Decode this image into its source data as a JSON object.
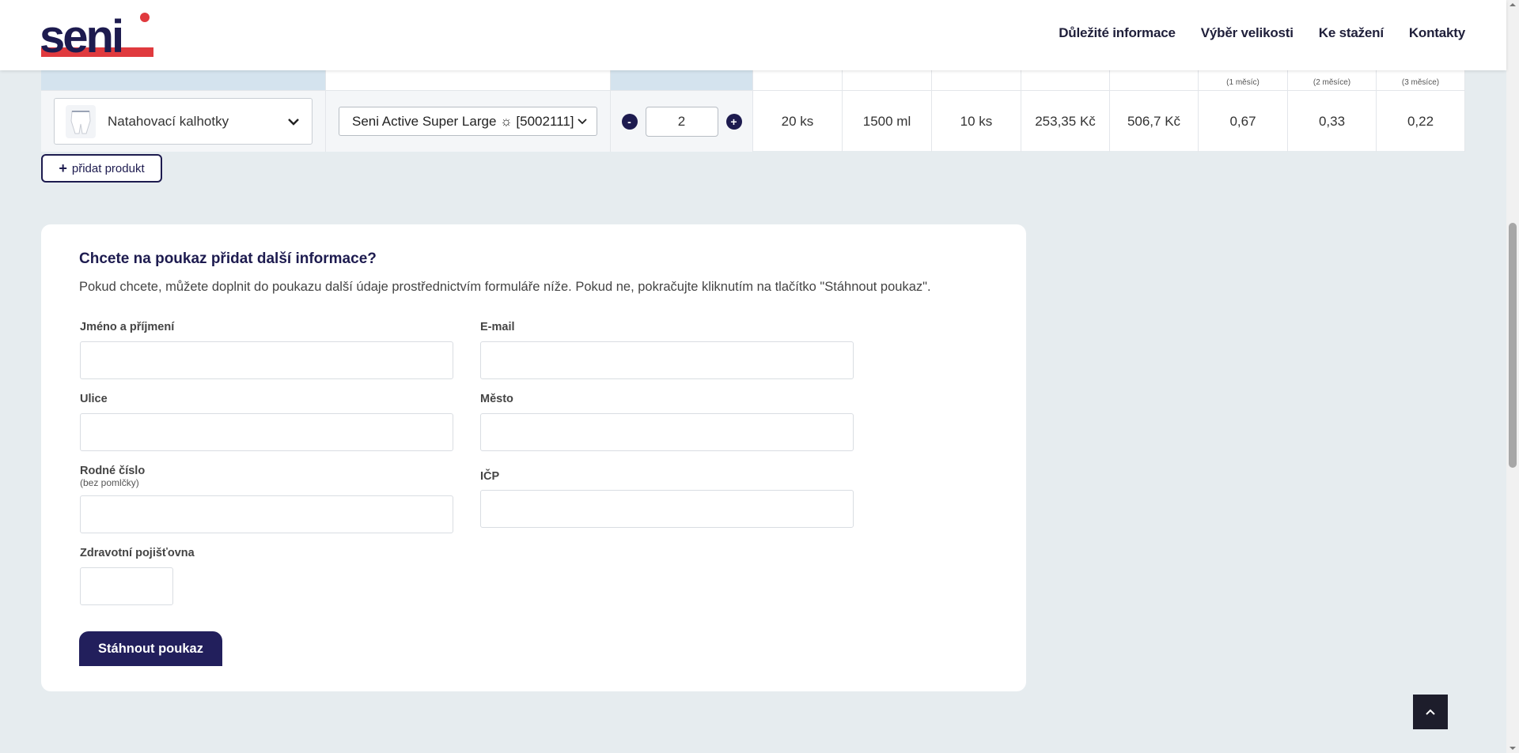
{
  "nav": {
    "items": [
      "Důležité informace",
      "Výběr velikosti",
      "Ke stažení",
      "Kontakty"
    ]
  },
  "logo_text": "seni",
  "table": {
    "header_subs": [
      "(1 měsíc)",
      "(2 měsíce)",
      "(3 měsíce)"
    ],
    "row": {
      "product_type": "Natahovací kalhotky",
      "variant": "Seni Active Super Large ☼ [5002111]",
      "quantity": "2",
      "qty_minus": "-",
      "qty_plus": "+",
      "cells": [
        "20 ks",
        "1500 ml",
        "10 ks",
        "253,35 Kč",
        "506,7 Kč",
        "0,67",
        "0,33",
        "0,22"
      ]
    },
    "add_label": "přidat produkt",
    "add_icon": "+"
  },
  "form": {
    "title": "Chcete na poukaz přidat další informace?",
    "intro": "Pokud chcete, můžete doplnit do poukazu další údaje prostřednictvím formuláře níže. Pokud ne, pokračujte kliknutím na tlačítko \"Stáhnout poukaz\".",
    "fields": {
      "name": "Jméno a příjmení",
      "email": "E-mail",
      "street": "Ulice",
      "city": "Město",
      "birth_number": "Rodné číslo",
      "birth_number_hint": "(bez pomlčky)",
      "icp": "IČP",
      "insurance": "Zdravotní pojišťovna"
    },
    "submit_label": "Stáhnout poukaz"
  },
  "colors": {
    "brand_navy": "#1d1b4f",
    "brand_red": "#e03a3e",
    "header_blue": "#d4e3ee",
    "page_bg": "#e6ecef"
  }
}
